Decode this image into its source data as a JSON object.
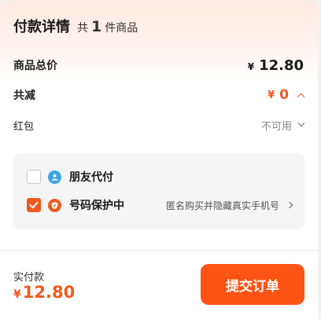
{
  "header": {
    "title": "付款详情",
    "count_prefix": "共",
    "count": "1",
    "count_suffix": "件商品"
  },
  "total": {
    "label": "商品总价",
    "currency": "¥",
    "amount": "12.80"
  },
  "discount": {
    "label": "共减",
    "currency": "¥",
    "amount": "0",
    "expanded": true
  },
  "red_packet": {
    "label": "红包",
    "status": "不可用"
  },
  "options": [
    {
      "label": "朋友代付",
      "checked": false,
      "icon": "friend-pay-icon",
      "icon_color": "#3aa4ea"
    },
    {
      "label": "号码保护中",
      "checked": true,
      "icon": "phone-shield-icon",
      "icon_color": "#f05a1e",
      "desc": "匿名购买并隐藏真实手机号"
    }
  ],
  "footer": {
    "pay_label": "实付款",
    "currency": "¥",
    "amount": "12.80",
    "submit_label": "提交订单"
  },
  "colors": {
    "accent": "#f05a1e",
    "button": "#fd5315"
  }
}
